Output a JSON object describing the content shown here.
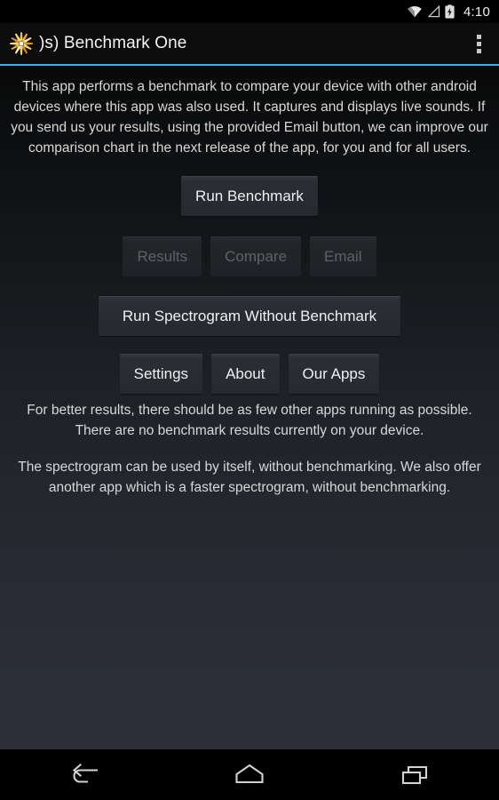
{
  "status_bar": {
    "clock": "4:10",
    "icons": [
      "wifi-icon",
      "cell-signal-icon",
      "battery-charging-icon"
    ]
  },
  "action_bar": {
    "app_icon": "starburst-app-icon",
    "title": ")s) Benchmark One",
    "overflow_icon": "overflow-menu-icon"
  },
  "accent_color": "#33b5e5",
  "main": {
    "intro_text": "This app performs a benchmark to compare your device with other android devices where this app was also used. It captures and displays live sounds. If you send us your results, using the provided Email button, we can improve our comparison chart in the next release of the app, for you and for all users.",
    "run_benchmark_label": "Run Benchmark",
    "secondary_buttons": [
      {
        "label": "Results",
        "enabled": false
      },
      {
        "label": "Compare",
        "enabled": false
      },
      {
        "label": "Email",
        "enabled": false
      }
    ],
    "spectrogram_label": "Run Spectrogram Without Benchmark",
    "tool_buttons": [
      {
        "label": "Settings",
        "enabled": true
      },
      {
        "label": "About",
        "enabled": true
      },
      {
        "label": "Our Apps",
        "enabled": true
      }
    ],
    "note_line_1": "For better results, there should be as few other apps running as possible.",
    "note_line_2": "There are no benchmark results currently on your device.",
    "spectrogram_note": "The spectrogram can be used by itself, without benchmarking. We also offer another app which is a faster spectrogram, without benchmarking."
  },
  "nav_bar": {
    "back_label": "Back",
    "home_label": "Home",
    "recents_label": "Recent apps"
  }
}
